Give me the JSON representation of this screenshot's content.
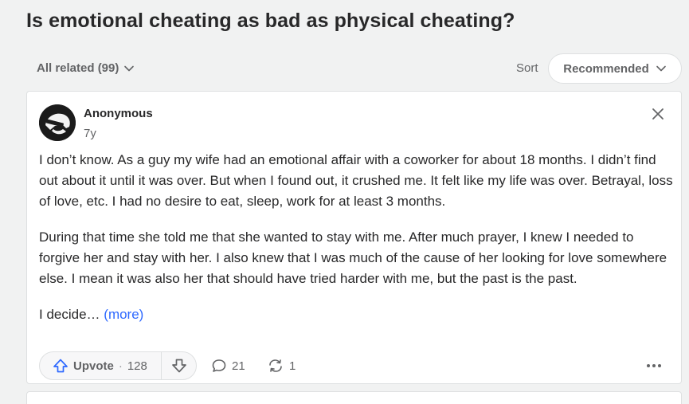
{
  "question": {
    "title": "Is emotional cheating as bad as physical cheating?"
  },
  "filters": {
    "all_related": "All related (99)",
    "sort_label": "Sort",
    "sort_value": "Recommended"
  },
  "answer": {
    "author": "Anonymous",
    "time": "7y",
    "paragraphs": [
      "I don’t know. As a guy my wife had an emotional affair with a coworker for about 18 months. I didn’t find out about it until it was over. But when I found out, it crushed me. It felt like my life was over. Betrayal, loss of love, etc. I had no desire to eat, sleep, work for at least 3 months.",
      "During that time she told me that she wanted to stay with me. After much prayer, I knew I needed to forgive her and stay with her. I also knew that I was much of the cause of her looking for love somewhere else. I mean it was also her that should have tried harder with me, but the past is the past."
    ],
    "truncated": "I decide…",
    "more_label": "(more)",
    "upvote_label": "Upvote",
    "upvote_sep": "·",
    "upvote_count": "128",
    "comment_count": "21",
    "share_count": "1"
  },
  "colors": {
    "background": "#f1f2f2",
    "card": "#ffffff",
    "link": "#2e69ff",
    "text": "#282829",
    "muted": "#636466"
  },
  "icons": [
    "chevron-down-icon",
    "close-icon",
    "upvote-arrow-icon",
    "downvote-arrow-icon",
    "comment-icon",
    "reshare-icon",
    "more-options-icon"
  ]
}
